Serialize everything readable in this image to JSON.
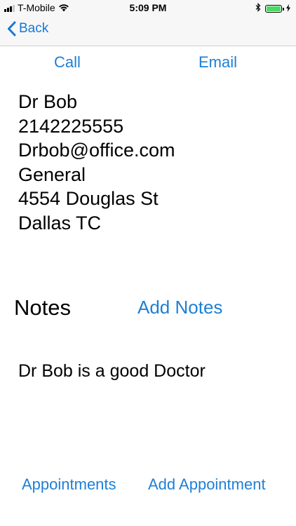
{
  "status_bar": {
    "carrier": "T-Mobile",
    "time": "5:09 PM",
    "battery_level": 1.0,
    "icons": [
      "signal-icon",
      "wifi-icon",
      "bluetooth-icon",
      "battery-icon",
      "charging-icon"
    ]
  },
  "nav": {
    "back_label": "Back"
  },
  "actions": {
    "call_label": "Call",
    "email_label": "Email"
  },
  "contact": {
    "name": "Dr Bob",
    "phone": "2142225555",
    "email": "Drbob@office.com",
    "specialty": "General",
    "street": "4554 Douglas St",
    "city": "Dallas TC"
  },
  "notes": {
    "title": "Notes",
    "add_label": "Add Notes",
    "text": "Dr Bob is a good Doctor"
  },
  "footer": {
    "appointments_label": "Appointments",
    "add_appointment_label": "Add Appointment"
  },
  "colors": {
    "accent": "#1e7fd6",
    "bar_background": "#f7f7f7",
    "battery_green": "#4cd964"
  }
}
